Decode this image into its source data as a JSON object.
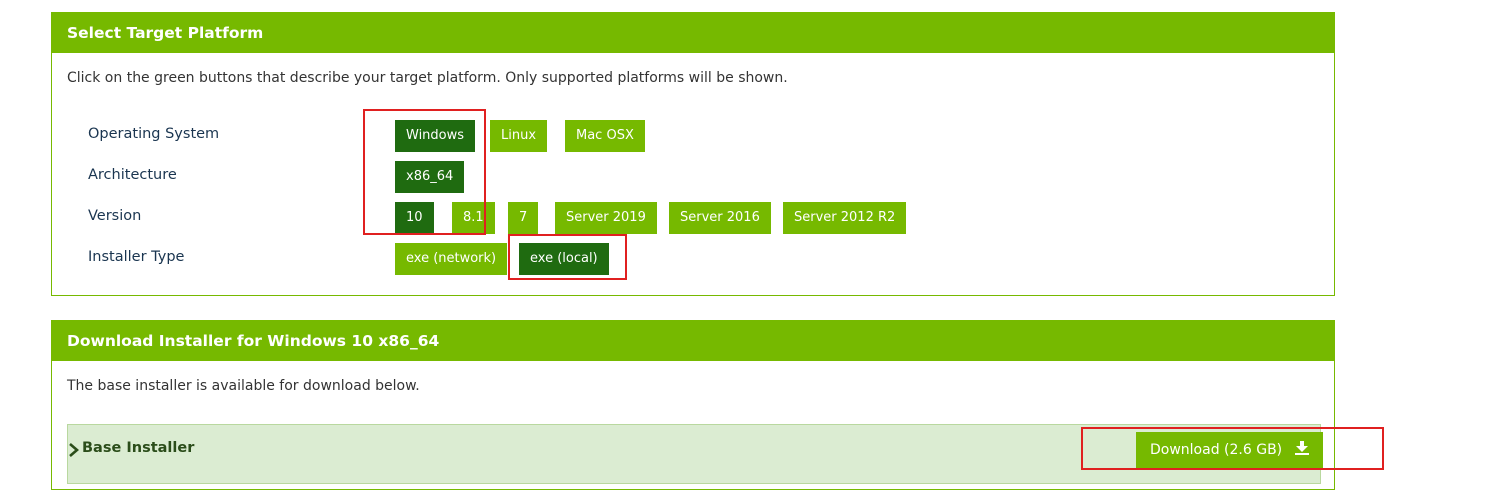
{
  "platform_panel": {
    "title": "Select Target Platform",
    "intro": "Click on the green buttons that describe your target platform. Only supported platforms will be shown.",
    "rows": [
      {
        "label": "Operating System",
        "options": [
          "Windows",
          "Linux",
          "Mac OSX"
        ],
        "selected": "Windows"
      },
      {
        "label": "Architecture",
        "options": [
          "x86_64"
        ],
        "selected": "x86_64"
      },
      {
        "label": "Version",
        "options": [
          "10",
          "8.1",
          "7",
          "Server 2019",
          "Server 2016",
          "Server 2012 R2"
        ],
        "selected": "10"
      },
      {
        "label": "Installer Type",
        "options": [
          "exe (network)",
          "exe (local)"
        ],
        "selected": "exe (local)"
      }
    ]
  },
  "download_panel": {
    "title": "Download Installer for Windows 10 x86_64",
    "intro": "The base installer is available for download below.",
    "base_installer_label": "Base Installer",
    "download_label": "Download (2.6 GB)",
    "icons": [
      "chevron-right-icon",
      "download-icon"
    ]
  },
  "colors": {
    "accent": "#76b900",
    "selected": "#1f6b10",
    "highlight_box": "#e02020",
    "base_row_bg": "#dbecd2"
  }
}
